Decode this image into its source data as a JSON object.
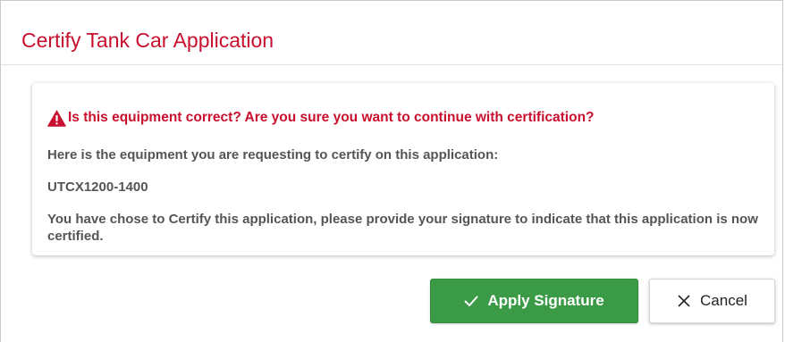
{
  "dialog": {
    "title": "Certify Tank Car Application"
  },
  "confirmation": {
    "warning_icon": "warning-triangle-icon",
    "warning_text": "Is this equipment correct? Are you sure you want to continue with certification?",
    "equipment_intro": "Here is the equipment you are requesting to certify on this application:",
    "equipment_id": "UTCX1200-1400",
    "signature_info": "You have chose to Certify this application, please provide your signature to indicate that this application is now certified."
  },
  "actions": {
    "apply_label": "Apply Signature",
    "apply_icon": "check-icon",
    "cancel_label": "Cancel",
    "cancel_icon": "close-icon"
  },
  "colors": {
    "title": "#c8102e",
    "warning": "#c8102e",
    "apply_button": "#3a9a45",
    "body_text": "#555555"
  }
}
